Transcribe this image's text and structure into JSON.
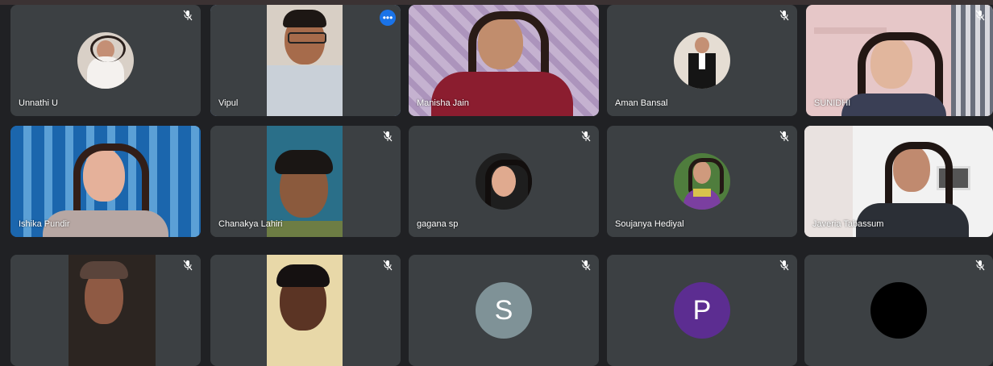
{
  "participants": [
    {
      "name": "Unnathi U",
      "muted": true
    },
    {
      "name": "Vipul",
      "muted": false,
      "active": true
    },
    {
      "name": "Manisha Jain",
      "muted": false
    },
    {
      "name": "Aman Bansal",
      "muted": true
    },
    {
      "name": "SUNIDHI",
      "muted": true
    },
    {
      "name": "Ishika Pundir",
      "muted": false
    },
    {
      "name": "Chanakya Lahiri",
      "muted": true
    },
    {
      "name": "gagana sp",
      "muted": true
    },
    {
      "name": "Soujanya Hediyal",
      "muted": true
    },
    {
      "name": "Javeria Tabassum",
      "muted": false
    },
    {
      "name": "",
      "muted": true
    },
    {
      "name": "",
      "muted": true
    },
    {
      "name": "",
      "muted": true,
      "avatar_letter": "S",
      "avatar_color": "#7f9297"
    },
    {
      "name": "",
      "muted": true,
      "avatar_letter": "P",
      "avatar_color": "#5c2d91"
    },
    {
      "name": "",
      "muted": true
    }
  ],
  "more_options_icon": "more-horizontal-icon",
  "mute_icon": "mic-off-icon"
}
